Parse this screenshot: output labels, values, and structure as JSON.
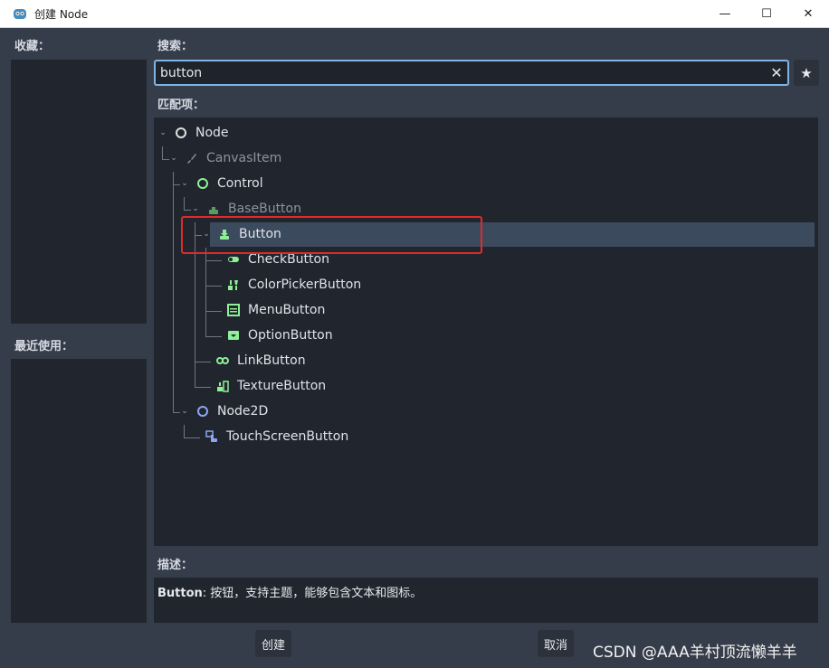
{
  "window": {
    "title": "创建 Node",
    "minimize": "—",
    "maximize": "☐",
    "close": "✕"
  },
  "sidebar": {
    "favorites_label": "收藏：",
    "recent_label": "最近使用："
  },
  "search": {
    "label": "搜索：",
    "value": "button",
    "clear": "✕",
    "favorite": "★"
  },
  "matches": {
    "label": "匹配项：",
    "items": [
      {
        "label": "Node",
        "icon": "node-circle-icon"
      },
      {
        "label": "CanvasItem",
        "icon": "brush-icon"
      },
      {
        "label": "Control",
        "icon": "control-circle-icon"
      },
      {
        "label": "BaseButton",
        "icon": "base-button-icon"
      },
      {
        "label": "Button",
        "icon": "button-icon"
      },
      {
        "label": "CheckButton",
        "icon": "toggle-icon"
      },
      {
        "label": "ColorPickerButton",
        "icon": "color-picker-icon"
      },
      {
        "label": "MenuButton",
        "icon": "menu-icon"
      },
      {
        "label": "OptionButton",
        "icon": "option-icon"
      },
      {
        "label": "LinkButton",
        "icon": "link-icon"
      },
      {
        "label": "TextureButton",
        "icon": "texture-button-icon"
      },
      {
        "label": "Node2D",
        "icon": "node2d-circle-icon"
      },
      {
        "label": "TouchScreenButton",
        "icon": "touch-icon"
      }
    ]
  },
  "description": {
    "label": "描述：",
    "name": "Button",
    "text": ": 按钮，支持主题，能够包含文本和图标。"
  },
  "buttons": {
    "create": "创建",
    "cancel": "取消"
  },
  "watermark": "CSDN @AAA羊村顶流懒羊羊",
  "colors": {
    "accent": "#7fb3e6",
    "control_green": "#8eef97",
    "node2d_blue": "#8da5f3",
    "highlight_red": "#e02b2b"
  }
}
